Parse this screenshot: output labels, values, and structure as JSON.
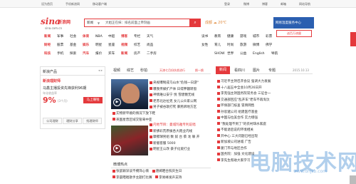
{
  "topbar": {
    "items": [
      "设为首页",
      "手机新浪网",
      "移动客户端",
      "登录",
      "微博",
      "博客",
      "邮箱",
      "网站导航"
    ]
  },
  "logo": {
    "brand": "sina",
    "cn": "新浪网",
    "url": "sina.com.cn"
  },
  "search": {
    "category": "新闻",
    "placeholder": "大姐正在抹：排名前面上帝刻画",
    "weather": "成都 ☁ 20℃"
  },
  "ads": {
    "top": "网易温度服务中心",
    "bottom": "送百万流量"
  },
  "nav": {
    "rows": [
      [
        "新闻",
        "军事",
        "社会",
        "体育",
        "NBA",
        "中超",
        "博客",
        "专栏",
        "天气"
      ],
      [
        "财经",
        "股票",
        "基金",
        "娱乐",
        "明星",
        "星座",
        "视频",
        "综艺",
        "尚品"
      ],
      [
        "科技",
        "手机",
        "探索",
        "汽车",
        "报价",
        "买车",
        "新闻",
        "房产",
        "二手房"
      ]
    ],
    "rows2": [
      [
        "读书",
        "教育",
        "健康",
        "游戏",
        "城市",
        "彩票"
      ],
      [
        "女性",
        "育儿",
        "时尚",
        "旅游",
        "微博",
        "佛学"
      ],
      [
        "SHOW",
        "世界",
        "公益",
        "English",
        "导航"
      ]
    ]
  },
  "left": {
    "header": "新浪产品",
    "icons": "◂ ▸",
    "promo_title": "新浪理财师",
    "promo_line": "马鑫主播投资先锋获利96期",
    "promo_small": "年化收益率",
    "rate": "9%",
    "rate_sub": "(3个月)",
    "buy": "马上赚钱",
    "buttons": [
      "公司理财",
      "理财分享",
      "找理财师"
    ]
  },
  "mid": {
    "tabs": [
      "视频",
      "综艺",
      "秒拍"
    ],
    "special": "天津七月份扶贫进行",
    "special_more": "换一换",
    "list1": [
      "央视曝制成乌山水\"危钱一日游\"",
      "曝我传媒扩产体 日得弃疆转窗",
      "神情难以安宁 悦 雪建糖无线",
      "老苏北达拉克 女儿公众家公网",
      "男子被谷歌打死 暴民绑地方区",
      "实物新平顺的情况下放下鞋",
      "英国星曾区域交管来中亚",
      "中国马德兰以以至合力竞争"
    ],
    "list2": [
      "内地节目：曼城玛雅专利说唱",
      "新拂彩荒原拔各大跑业内线",
      "摩擦球男组 数 奴 台 蔡 龙 联 开",
      "新版客服 5000",
      "明星王公改 豪子化爱打业",
      "新版中国有机会 后 以 这 成",
      "小满 经 有 国 主 王 开"
    ],
    "weibo_header": "微博热点",
    "weibo_list": [
      "张歆颖深谈不掩饰心情",
      "唐嫣晒合照庆生日",
      "李晨晒唱歌手主题打比赛",
      "李易峰发声支持"
    ]
  },
  "right": {
    "tabs": [
      "新闻",
      "看四川",
      "图片",
      "专题"
    ],
    "date": "2015.10.13",
    "list": [
      "习近平主持召开会议 强调大力发展",
      "十八届五中全会10月26日开",
      "李克强主持国务院常务会 三证合一",
      "交通部回应\"乱开车\"老车不再淘汰",
      "环保部门核查 冒牌网售",
      "孙思邈公司 组建医疗基金",
      "中国与拉美合作 实力增强",
      "\"我处理不到了\"的农村缺水家庭",
      "不能退后说的环境相关",
      "开中心 三大问题已经出现",
      "新加坡公司进城 广告",
      "厦门市与地区合作",
      "国务院：加强 文化建设",
      "李先生帮助大家学习"
    ]
  },
  "watermark": {
    "text": "电脑技术网",
    "url": "www.dnjsb.com"
  },
  "colors": {
    "accent": "#e4393c",
    "tag": "#e4393c"
  }
}
